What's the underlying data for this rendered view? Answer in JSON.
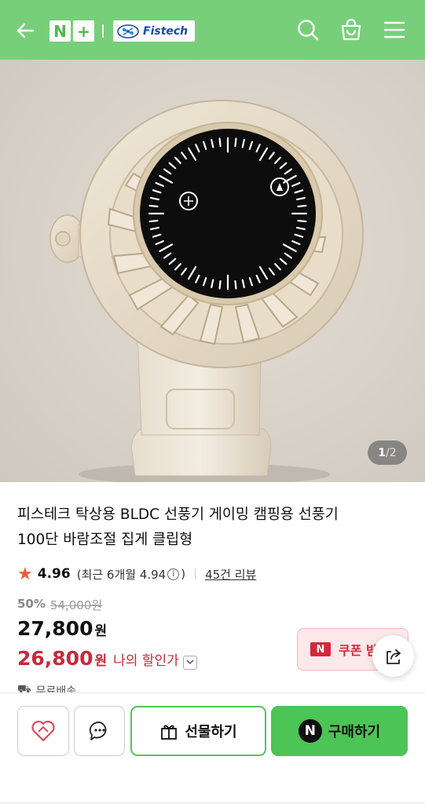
{
  "header": {
    "back_icon": "arrow-left-icon",
    "badge_n": "N",
    "badge_plus": "+",
    "brand_name": "Fistech",
    "search_icon": "search-icon",
    "cart_icon": "shopping-bag-icon",
    "menu_icon": "hamburger-menu-icon",
    "bg_color": "#78cf7a"
  },
  "gallery": {
    "current": "1",
    "separator": "/",
    "total": "2"
  },
  "product": {
    "title_line1": "피스테크 탁상용 BLDC 선풍기 게이밍 캠핑용 선풍기",
    "title_line2": "100단 바람조절 집게 클립형",
    "rating": {
      "score": "4.96",
      "recent_text": "(최근 6개월 4.94",
      "info_glyph": "i",
      "close_paren": ")",
      "review_link": "45건 리뷰"
    },
    "pricing": {
      "discount_rate": "50%",
      "original_price": "54,000원",
      "sale_price": "27,800",
      "currency": "원",
      "my_price": "26,800",
      "my_price_currency": "원",
      "my_price_label": "나의 할인가"
    },
    "coupon": {
      "badge": "N",
      "label": "쿠폰 받"
    },
    "shipping_text": "무료배송"
  },
  "bottom_bar": {
    "like_icon": "heart-icon",
    "chat_icon": "chat-bubble-icon",
    "gift_label": "선물하기",
    "gift_icon": "gift-icon",
    "buy_badge": "N",
    "buy_label": "구매하기",
    "buy_color": "#4cc456"
  }
}
